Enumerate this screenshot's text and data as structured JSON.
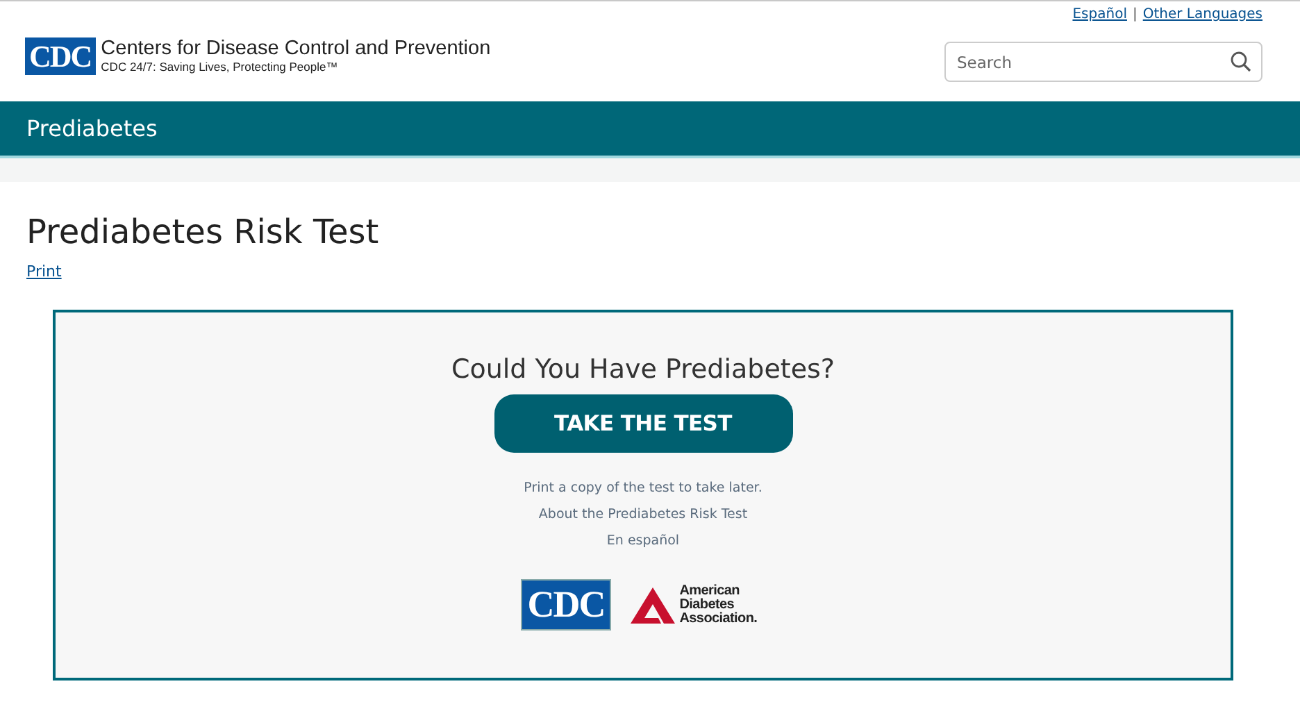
{
  "header": {
    "logo": {
      "mark": "CDC",
      "name": "Centers for Disease Control and Prevention",
      "tagline": "CDC 24/7: Saving Lives, Protecting People™"
    },
    "language_links": [
      "Español",
      "Other Languages"
    ],
    "separator": "|",
    "search": {
      "placeholder": "Search"
    }
  },
  "topic_bar": {
    "title": "Prediabetes"
  },
  "page": {
    "title": "Prediabetes Risk Test",
    "print_link": "Print"
  },
  "promo": {
    "heading": "Could You Have Prediabetes?",
    "button": "TAKE THE TEST",
    "links": [
      "Print a copy of the test to take later.",
      "About the Prediabetes Risk Test",
      "En español"
    ],
    "partner_logos": [
      {
        "kind": "cdc",
        "text": "CDC"
      },
      {
        "kind": "ada",
        "text": "American Diabetes Association."
      }
    ]
  }
}
